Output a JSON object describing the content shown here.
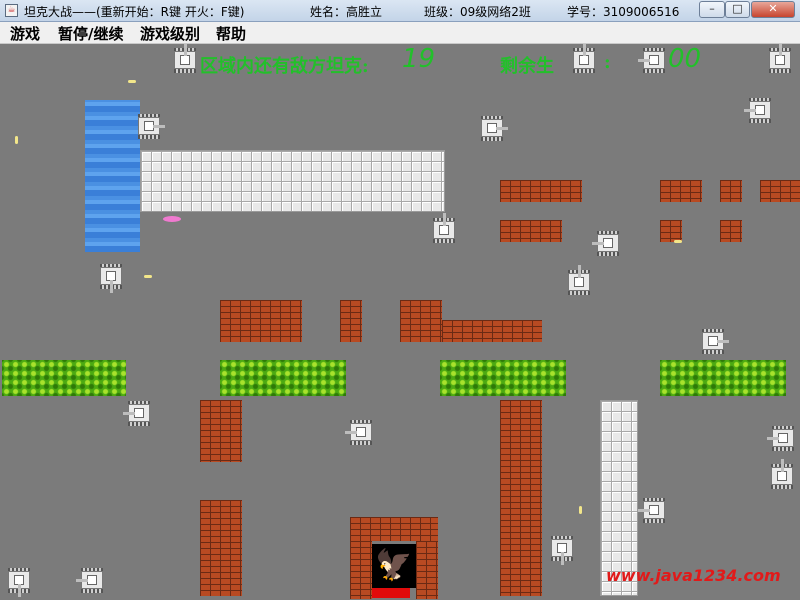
{
  "window": {
    "title": "坦克大战——(重新开始：R键  开火：F键)",
    "name_label": "姓名：高胜立",
    "class_label": "班级：09级网络2班",
    "student_id_label": "学号：3109006516",
    "minimize": "–",
    "maximize": "□",
    "close": "✕"
  },
  "menu": {
    "items": [
      "游戏",
      "暂停/继续",
      "游戏级别",
      "帮助"
    ]
  },
  "hud": {
    "enemies_label": "区域内还有敌方坦克:",
    "enemies_count": "19",
    "lives_label": "剩余生",
    "lives_colon": ":",
    "lives_count": "00"
  },
  "watermark": "www.java1234.com",
  "colors": {
    "background": "#7b7b7b",
    "hud_text": "#22c02a",
    "brick": "#b84a22",
    "grass": "#4caa12",
    "water": "#4a90e2",
    "base_bar": "#e10b0b",
    "watermark": "#e11a1a"
  },
  "icons": {
    "app": "java-cup-icon",
    "base": "eagle-icon"
  }
}
